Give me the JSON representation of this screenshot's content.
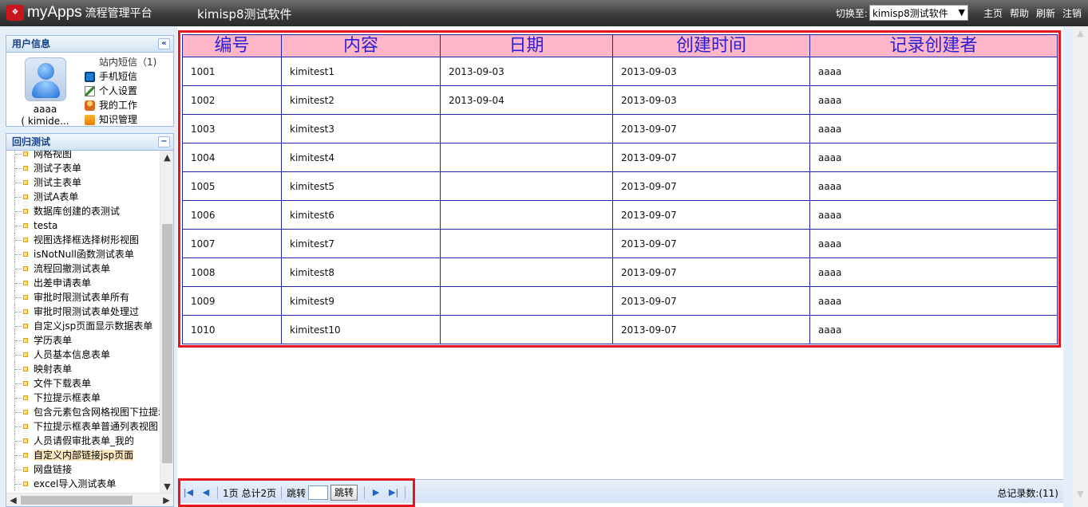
{
  "header": {
    "logo_text": "myApps",
    "logo_sub": "流程管理平台",
    "app_name": "kimisp8测试软件",
    "switch_label": "切换至:",
    "switch_value": "kimisp8测试软件",
    "links": [
      "主页",
      "帮助",
      "刷新",
      "注销"
    ]
  },
  "user_panel": {
    "title": "用户信息",
    "collapse_icon": "«",
    "name": "aaaa",
    "account": "( kimide...",
    "message": "站内短信（1)",
    "menu": [
      "手机短信",
      "个人设置",
      "我的工作",
      "知识管理"
    ]
  },
  "tree_panel": {
    "title": "回归测试",
    "collapse_icon": "−",
    "items": [
      "网格视图",
      "测试子表单",
      "测试主表单",
      "测试A表单",
      "数据库创建的表测试",
      "testa",
      "视图选择框选择树形视图",
      "isNotNull函数测试表单",
      "流程回撤测试表单",
      "出差申请表单",
      "审批时限测试表单所有",
      "审批时限测试表单处理过",
      "自定义jsp页面显示数据表单",
      "学历表单",
      "人员基本信息表单",
      "映射表单",
      "文件下载表单",
      "下拉提示框表单",
      "包含元素包含网格视图下拉提示",
      "下拉提示框表单普通列表视图",
      "人员请假审批表单_我的",
      "自定义内部链接jsp页面",
      "网盘链接",
      "excel导入测试表单"
    ],
    "selected_index": 21
  },
  "grid": {
    "columns": [
      "编号",
      "内容",
      "日期",
      "创建时间",
      "记录创建者"
    ],
    "rows": [
      [
        "1001",
        "kimitest1",
        "2013-09-03",
        "2013-09-03",
        "aaaa"
      ],
      [
        "1002",
        "kimitest2",
        "2013-09-04",
        "2013-09-03",
        "aaaa"
      ],
      [
        "1003",
        "kimitest3",
        "",
        "2013-09-07",
        "aaaa"
      ],
      [
        "1004",
        "kimitest4",
        "",
        "2013-09-07",
        "aaaa"
      ],
      [
        "1005",
        "kimitest5",
        "",
        "2013-09-07",
        "aaaa"
      ],
      [
        "1006",
        "kimitest6",
        "",
        "2013-09-07",
        "aaaa"
      ],
      [
        "1007",
        "kimitest7",
        "",
        "2013-09-07",
        "aaaa"
      ],
      [
        "1008",
        "kimitest8",
        "",
        "2013-09-07",
        "aaaa"
      ],
      [
        "1009",
        "kimitest9",
        "",
        "2013-09-07",
        "aaaa"
      ],
      [
        "1010",
        "kimitest10",
        "",
        "2013-09-07",
        "aaaa"
      ]
    ]
  },
  "pager": {
    "page_info": "1页 总计2页",
    "jump_label": "跳转",
    "go_label": "跳转",
    "jump_value": "",
    "total": "总记录数:(11)"
  },
  "colors": {
    "header_bg": "#ffb6c8",
    "header_text": "#2b1fd6",
    "highlight_border": "#e4161e",
    "panel_title": "#15428b"
  }
}
